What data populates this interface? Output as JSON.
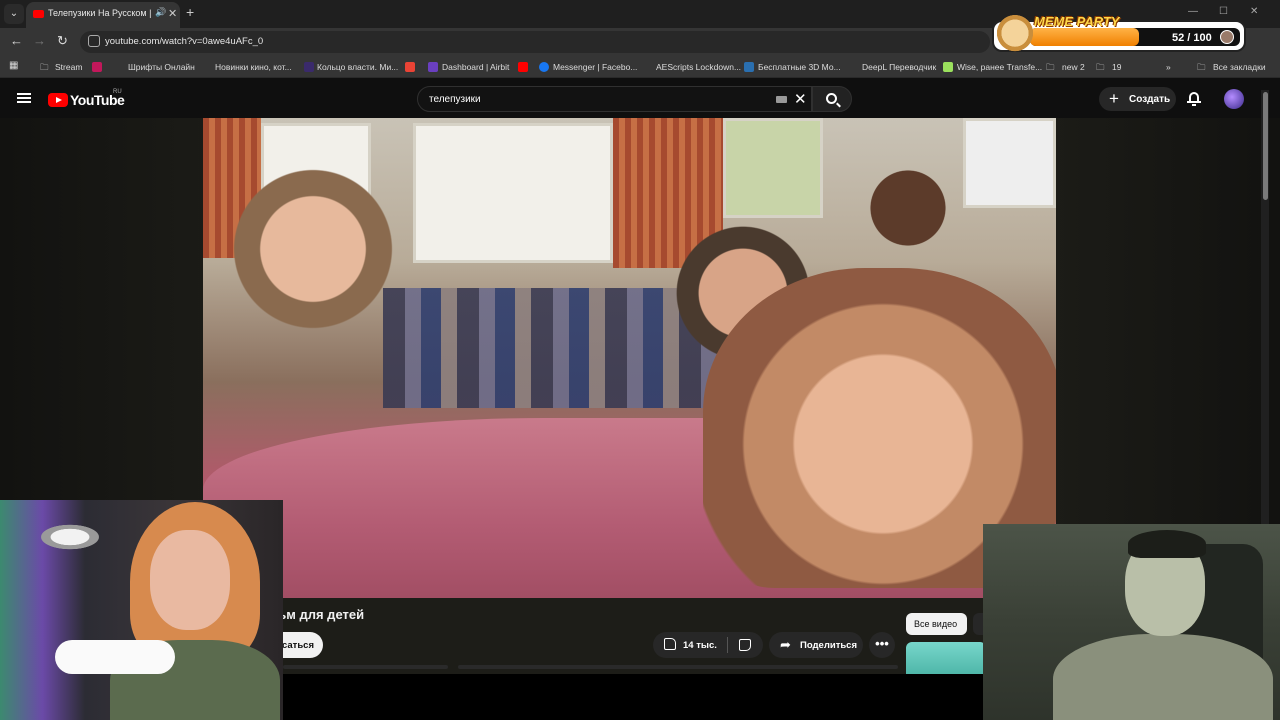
{
  "browser": {
    "tab": {
      "title": "Телепузики На Русском | Р",
      "favicon": "youtube-favicon-icon"
    },
    "url": "youtube.com/watch?v=0awe4uAFc_0",
    "bookmarks": [
      "Stream",
      "Шрифты Онлайн",
      "Новинки кино, кот...",
      "Кольцо власти. Ми...",
      "Dashboard | Airbit",
      "Messenger | Facebo...",
      "AEScripts Lockdown...",
      "Бесплатные 3D Мо...",
      "DeepL Переводчик",
      "Wise, ранее Transfe...",
      "new 2",
      "19",
      "Все закладки"
    ]
  },
  "meme_party": {
    "logo": "MEME PARTY",
    "count_text": "52 / 100",
    "progress": 0.52,
    "accent": "#f08000"
  },
  "youtube": {
    "logo_text": "YouTube",
    "region": "RU",
    "search_query": "телепузики",
    "create_label": "Создать",
    "brand_color": "#ff0000"
  },
  "video": {
    "title_visible": "льм для детей",
    "subscribe_partial": "саться",
    "likes": "14 тыс.",
    "share_label": "Поделиться",
    "more_label": "•••"
  },
  "sidebar": {
    "chip_all": "Все видео"
  }
}
